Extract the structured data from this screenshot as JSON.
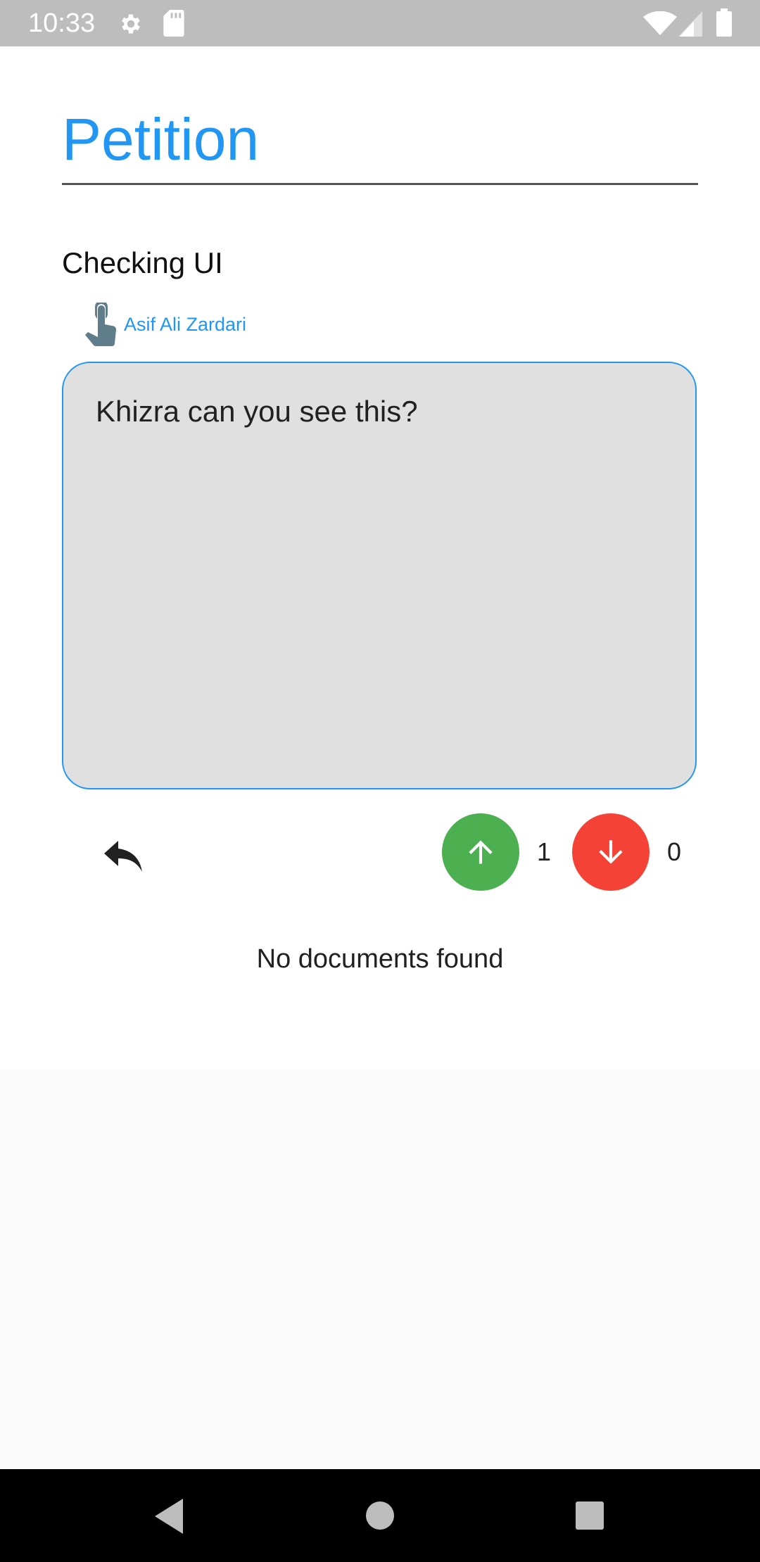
{
  "status_bar": {
    "time": "10:33",
    "icons": [
      "gear-icon",
      "sd-card-icon",
      "wifi-icon",
      "signal-icon",
      "battery-icon"
    ]
  },
  "page": {
    "title": "Petition",
    "petition_title": "Checking UI",
    "author": "Asif Ali Zardari",
    "message": "Khizra can you see this?",
    "empty_documents": "No documents found"
  },
  "votes": {
    "up_count": "1",
    "down_count": "0",
    "up_color": "#4caf50",
    "down_color": "#f44336"
  },
  "colors": {
    "accent": "#2196f3",
    "status_bar": "#bdbdbd",
    "message_bg": "#e0e0e0"
  },
  "nav_bar": {
    "icons": [
      "back-icon",
      "home-icon",
      "recents-icon"
    ]
  }
}
